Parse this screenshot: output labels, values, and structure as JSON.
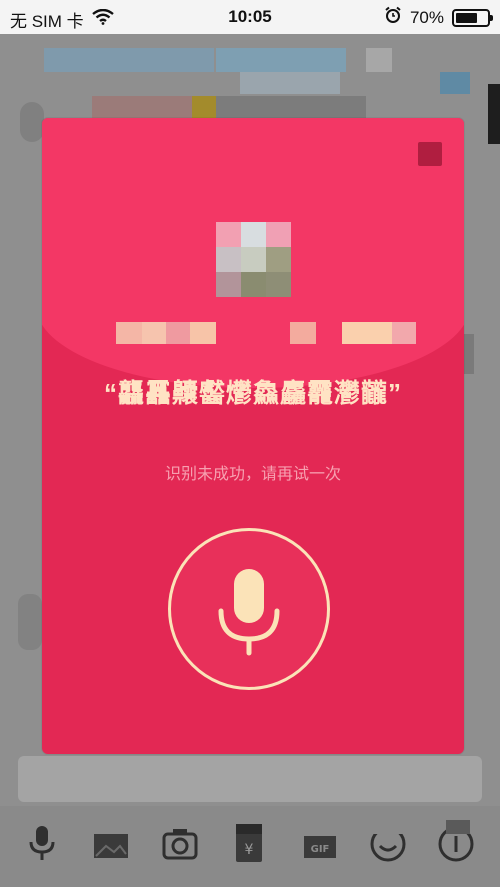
{
  "status_bar": {
    "carrier": "无 SIM 卡",
    "time": "10:05",
    "battery": "70%",
    "battery_level": 0.7,
    "icons": [
      "wifi-icon",
      "alarm-icon",
      "battery-icon"
    ]
  },
  "modal": {
    "recognized_text": "“龘靐齉齾爩鱻麤龗灪龖”",
    "hint": "识别未成功，请再试一次",
    "icons": [
      "close-icon",
      "microphone-icon"
    ]
  },
  "toolbar": {
    "icons": [
      "microphone-icon",
      "image-icon",
      "camera-icon",
      "red-packet-icon",
      "gif-icon",
      "emoji-icon",
      "plus-icon"
    ]
  },
  "colors": {
    "envelope": "#e32854",
    "flap": "#f33765",
    "accent": "#fbe3b8",
    "hint": "#f7a0b0"
  }
}
